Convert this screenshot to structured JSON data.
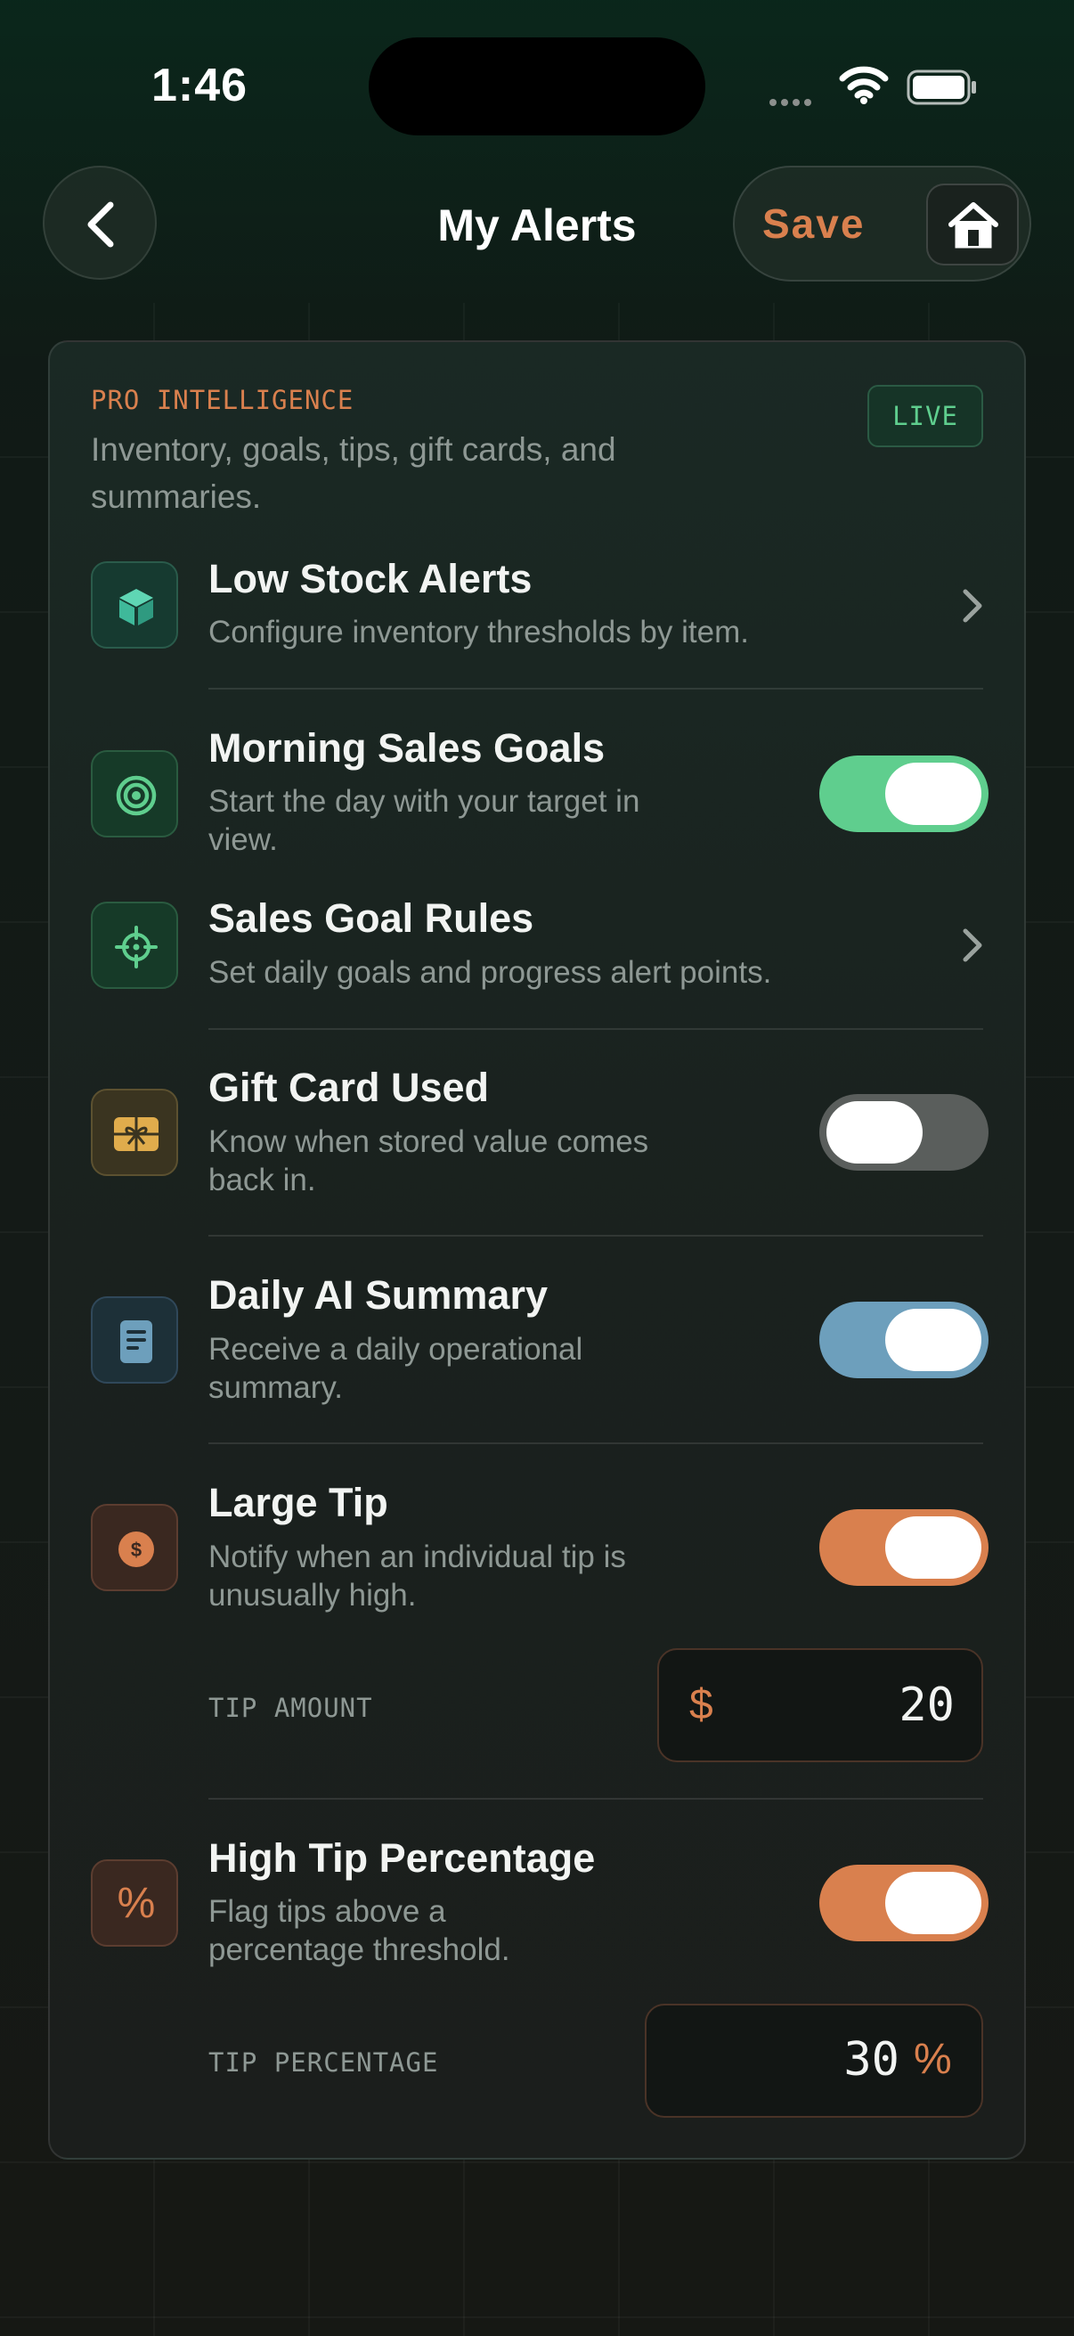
{
  "status_bar": {
    "time": "1:46"
  },
  "header": {
    "title": "My Alerts",
    "save_label": "Save"
  },
  "section": {
    "label": "PRO INTELLIGENCE",
    "description": "Inventory, goals, tips, gift cards, and summaries.",
    "badge": "LIVE"
  },
  "alerts": [
    {
      "title": "Low Stock Alerts",
      "description": "Configure inventory thresholds by item.",
      "control": "chevron",
      "icon": "box-icon",
      "color": "#3fb99a"
    },
    {
      "title": "Morning Sales Goals",
      "description": "Start the day with your target in view.",
      "control": "toggle",
      "enabled": true,
      "icon": "target-icon",
      "color": "#5fce8e"
    },
    {
      "title": "Sales Goal Rules",
      "description": "Set daily goals and progress alert points.",
      "control": "chevron",
      "icon": "crosshair-icon",
      "color": "#5fce8e"
    },
    {
      "title": "Gift Card Used",
      "description": "Know when stored value comes back in.",
      "control": "toggle",
      "enabled": false,
      "icon": "gift-card-icon",
      "color": "#e0ac4c"
    },
    {
      "title": "Daily AI Summary",
      "description": "Receive a daily operational summary.",
      "control": "toggle",
      "enabled": true,
      "icon": "document-icon",
      "color": "#6d9fbc"
    },
    {
      "title": "Large Tip",
      "description": "Notify when an individual tip is unusually high.",
      "control": "toggle",
      "enabled": true,
      "icon": "dollar-coin-icon",
      "color": "#d9804e"
    },
    {
      "title": "High Tip Percentage",
      "description": "Flag tips above a percentage threshold.",
      "control": "toggle",
      "enabled": true,
      "icon": "percent-icon",
      "color": "#d9804e"
    }
  ],
  "tip_amount": {
    "label": "TIP AMOUNT",
    "prefix": "$",
    "value": "20"
  },
  "tip_percentage": {
    "label": "TIP PERCENTAGE",
    "value": "30",
    "suffix": "%"
  },
  "colors": {
    "accent_orange": "#d9804e",
    "accent_green": "#5fce8e",
    "accent_blue": "#6d9fbc",
    "toggle_off": "#5a5e5c"
  }
}
